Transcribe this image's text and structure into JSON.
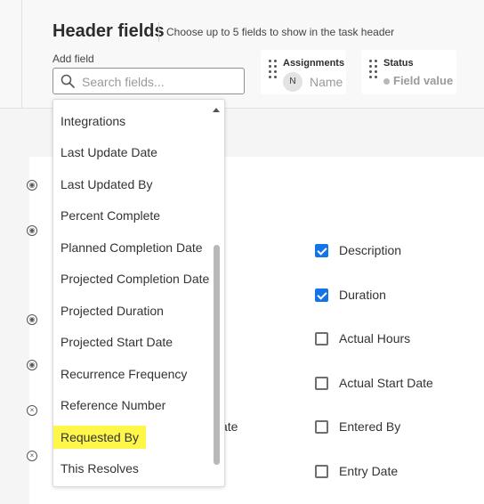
{
  "header": {
    "title": "Header fields",
    "subtitle": "Choose up to 5 fields to show in the task header",
    "add_field_label": "Add field",
    "search_placeholder": "Search fields...",
    "cards": [
      {
        "title": "Assignments",
        "avatar_initial": "N",
        "value": "Name"
      },
      {
        "title": "Status",
        "value": "Field value"
      }
    ]
  },
  "dropdown": {
    "items": [
      "Integrations",
      "Last Update Date",
      "Last Updated By",
      "Percent Complete",
      "Planned Completion Date",
      "Projected Completion Date",
      "Projected Duration",
      "Projected Start Date",
      "Recurrence Frequency",
      "Reference Number",
      "Requested By",
      "This Resolves"
    ],
    "highlighted": "Requested By"
  },
  "fields": {
    "partial_label": "ate",
    "checkboxes": [
      {
        "label": "Description",
        "checked": true
      },
      {
        "label": "Duration",
        "checked": true
      },
      {
        "label": "Actual Hours",
        "checked": false
      },
      {
        "label": "Actual Start Date",
        "checked": false
      },
      {
        "label": "Entered By",
        "checked": false
      },
      {
        "label": "Entry Date",
        "checked": false
      }
    ]
  },
  "colors": {
    "accent": "#1473e6",
    "highlight": "#fff64a"
  }
}
